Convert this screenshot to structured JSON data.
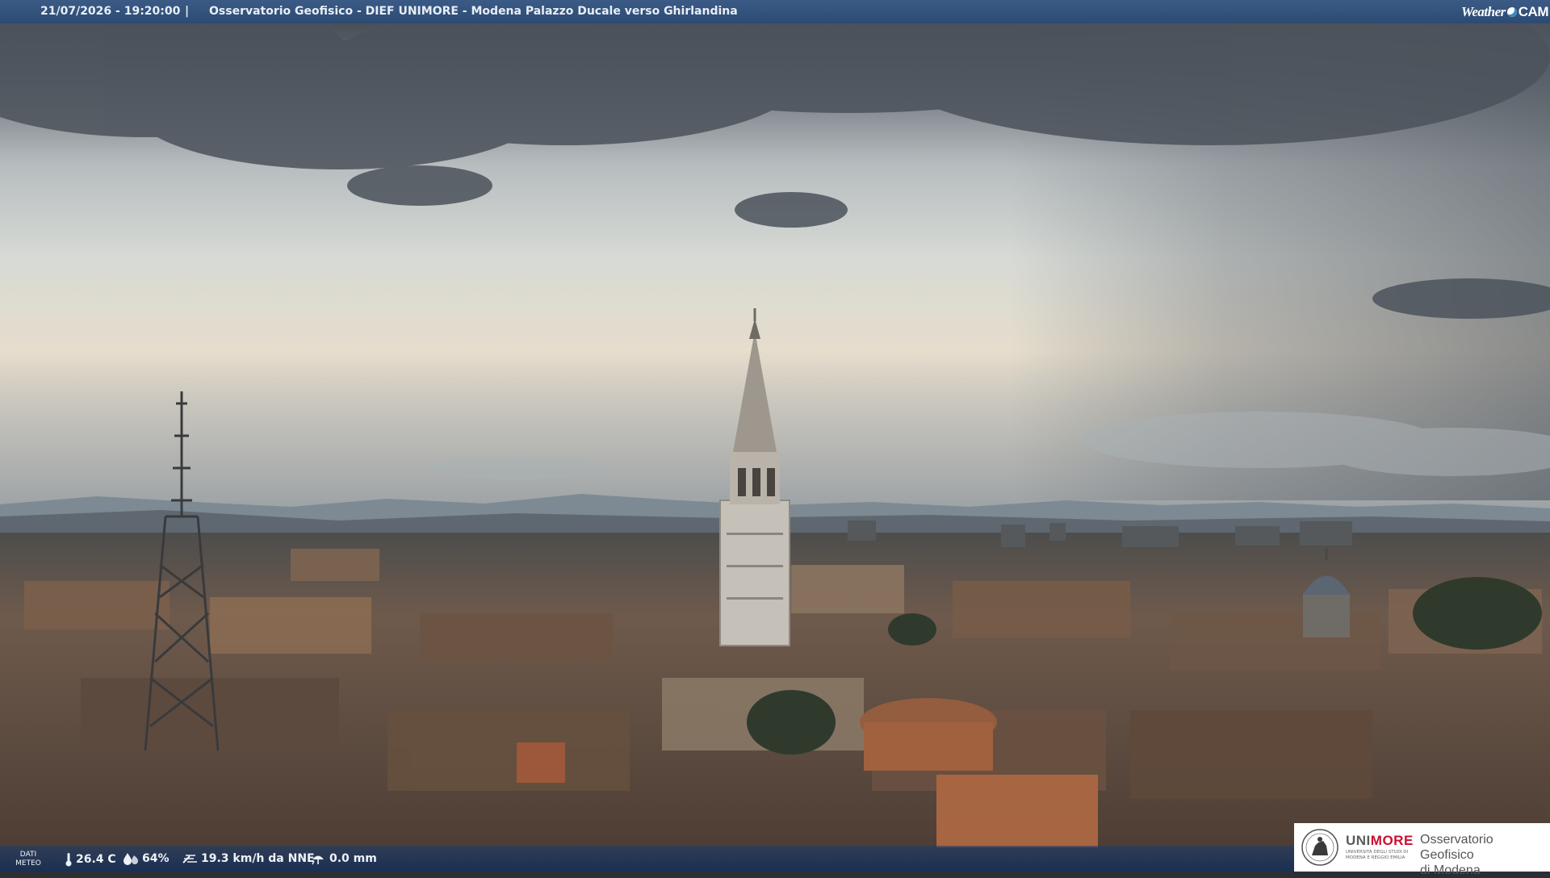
{
  "overlay": {
    "timestamp": "21/07/2026 - 19:20:00",
    "separator": "|",
    "title": "Osservatorio Geofisico - DIEF UNIMORE - Modena Palazzo Ducale verso Ghirlandina",
    "brand_left": "Weather",
    "brand_right": "CAM"
  },
  "weather_bar": {
    "label_line1": "DATI",
    "label_line2": "METEO",
    "temperature": "26.4 C",
    "humidity": "64%",
    "wind": "19.3 km/h da NNE",
    "rain": "0.0 mm",
    "icons": [
      "thermometer-icon",
      "humidity-drop-icon",
      "wind-icon",
      "rain-icon"
    ]
  },
  "logo": {
    "uni_prefix": "UNI",
    "uni_suffix": "MORE",
    "uni_subtitle": "UNIVERSITÀ DEGLI STUDI DI MODENA E REGGIO EMILIA",
    "observatory_line1": "Osservatorio Geofisico",
    "observatory_line2": "di Modena"
  },
  "colors": {
    "bar": "#2c4a72",
    "unimore_red": "#c8102e",
    "sky_light": "#dfe2de",
    "sky_dark": "#3f4650",
    "roofs": "#6a5344"
  }
}
